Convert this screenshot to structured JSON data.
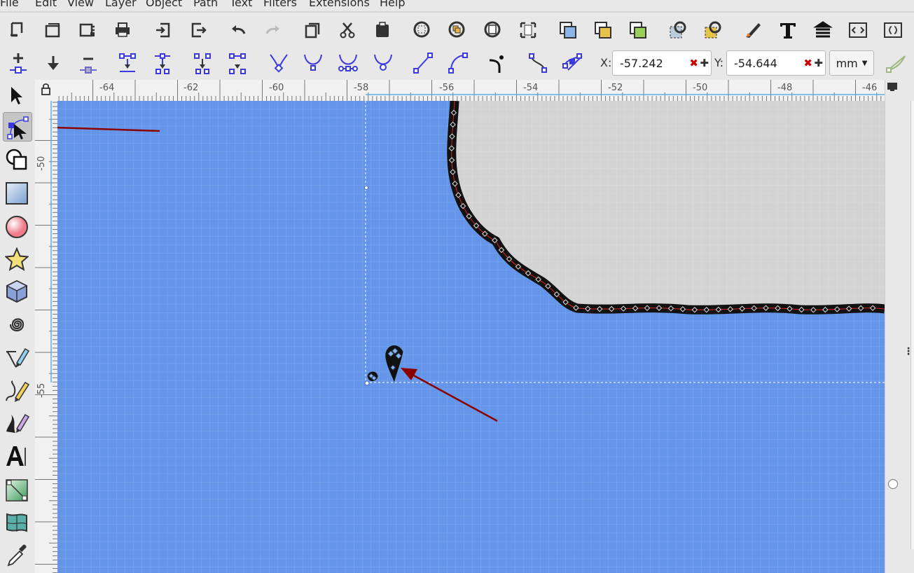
{
  "menu": [
    "File",
    "Edit",
    "View",
    "Layer",
    "Object",
    "Path",
    "Text",
    "Filters",
    "Extensions",
    "Help"
  ],
  "command_icons": [
    "new-document-icon",
    "open-icon",
    "open-recent-icon",
    "print-icon",
    "import-icon",
    "export-icon",
    "undo-icon",
    "redo-icon",
    "copy-icon",
    "cut-icon",
    "paste-icon",
    "zoom-selection-icon",
    "zoom-drawing-icon",
    "zoom-page-icon",
    "zoom-page-width-icon",
    "duplicate-icon",
    "clone-icon",
    "unlink-clone-icon",
    "select-same-icon",
    "find-icon",
    "fill-stroke-icon",
    "text-font-icon",
    "align-distribute-icon",
    "xml-editor-icon",
    "object-properties-icon"
  ],
  "node_toolbar": {
    "x_label": "X:",
    "x_value": "-57.242",
    "y_label": "Y:",
    "y_value": "-54.644",
    "unit": "mm"
  },
  "tools": [
    "selector-tool",
    "node-tool",
    "shape-builder-tool",
    "rectangle-tool",
    "ellipse-tool",
    "star-tool",
    "3d-box-tool",
    "spiral-tool",
    "pen-tool",
    "pencil-tool",
    "calligraphy-tool",
    "text-tool",
    "gradient-tool",
    "mesh-tool",
    "dropper-tool"
  ],
  "rulers": {
    "horizontal": [
      "-64",
      "-62",
      "-60",
      "-58",
      "-56",
      "-54",
      "-52",
      "-50",
      "-48",
      "-46"
    ],
    "vertical": [
      "-50",
      "-55"
    ]
  },
  "colors": {
    "canvas_bg": "#6495e8",
    "gray_area": "#d3d3d3",
    "arrow": "#8b0000",
    "path_stroke": "#111111"
  }
}
